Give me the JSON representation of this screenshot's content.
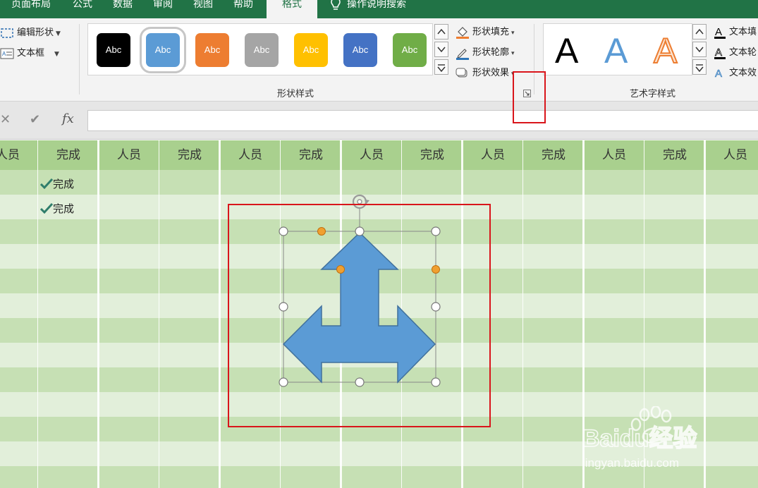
{
  "tabs": [
    {
      "label": "页面布局",
      "active": false
    },
    {
      "label": "公式",
      "active": false
    },
    {
      "label": "数据",
      "active": false
    },
    {
      "label": "审阅",
      "active": false
    },
    {
      "label": "视图",
      "active": false
    },
    {
      "label": "帮助",
      "active": false
    },
    {
      "label": "格式",
      "active": true
    }
  ],
  "tell_me": "操作说明搜索",
  "ribbon": {
    "insert_shapes": {
      "edit_shape": "编辑形状",
      "text_box": "文本框"
    },
    "shape_styles": {
      "label": "形状样式",
      "swatches": [
        {
          "text": "Abc",
          "color": "#000000"
        },
        {
          "text": "Abc",
          "color": "#5b9bd5",
          "selected": true
        },
        {
          "text": "Abc",
          "color": "#ed7d31"
        },
        {
          "text": "Abc",
          "color": "#a5a5a5"
        },
        {
          "text": "Abc",
          "color": "#ffc000"
        },
        {
          "text": "Abc",
          "color": "#4472c4"
        },
        {
          "text": "Abc",
          "color": "#70ad47"
        }
      ],
      "fill": "形状填充",
      "outline": "形状轮廓",
      "effects": "形状效果"
    },
    "wordart_styles": {
      "label": "艺术字样式",
      "samples": [
        "A",
        "A",
        "A"
      ],
      "text_fill": "文本填",
      "text_outline": "文本轮",
      "text_effects": "文本效"
    }
  },
  "formula_bar": {
    "cancel": "✕",
    "enter": "✔",
    "fx": "fx",
    "value": ""
  },
  "sheet": {
    "headers": [
      "人员",
      "完成",
      "人员",
      "完成",
      "人员",
      "完成",
      "人员",
      "完成",
      "人员",
      "完成",
      "人员",
      "完成",
      "人员"
    ],
    "checked_rows": [
      "完成",
      "完成"
    ]
  },
  "colors": {
    "header_green": "#a9d08e",
    "band_light": "#e2efda",
    "band_dark": "#c6e0b4",
    "shape_fill": "#5b9bd5",
    "shape_stroke": "#41719c",
    "highlight_red": "#d9151b",
    "ribbon_green": "#217346"
  },
  "watermark": {
    "brand": "Baidu经验",
    "url": "jingyan.baidu.com"
  }
}
